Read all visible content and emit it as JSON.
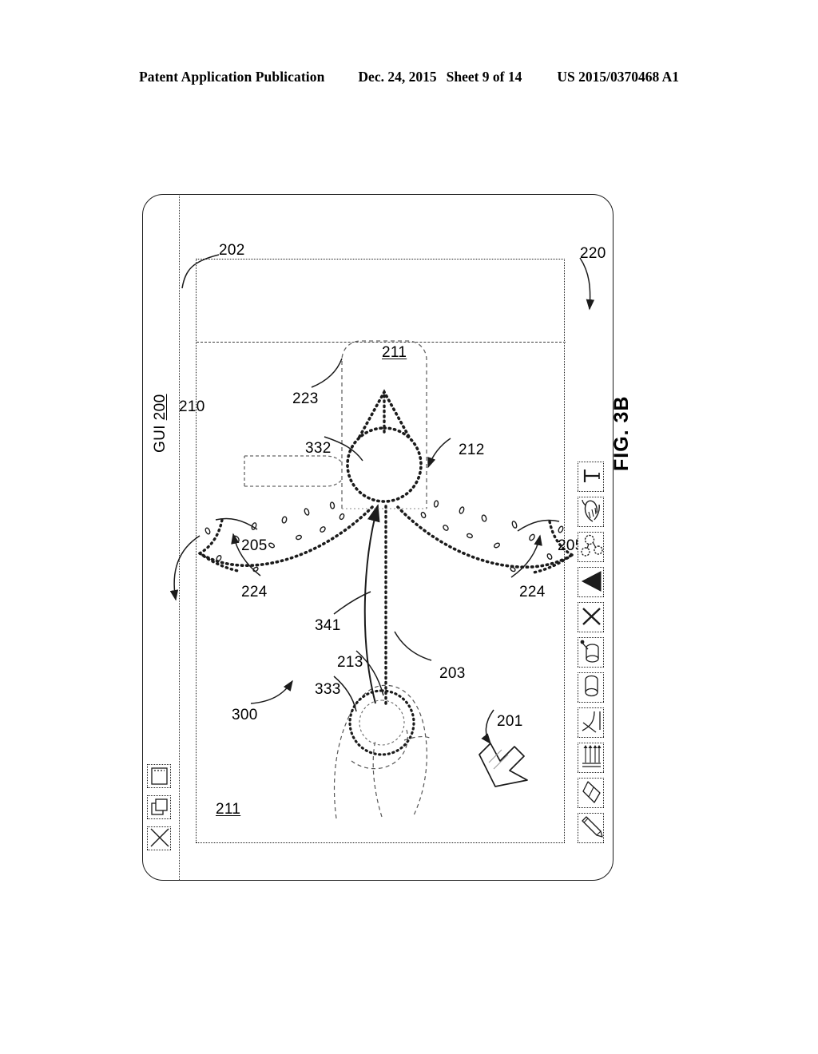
{
  "header": {
    "publication": "Patent Application Publication",
    "date": "Dec. 24, 2015",
    "sheet": "Sheet 9 of 14",
    "patent_number": "US 2015/0370468 A1"
  },
  "figure": {
    "caption": "FIG. 3B"
  },
  "window": {
    "gui_label_text": "GUI ",
    "gui_label_number": "200",
    "controls": [
      {
        "name": "close-button",
        "glyph": "x-box"
      },
      {
        "name": "restore-button",
        "glyph": "overlapping-squares"
      },
      {
        "name": "minimize-button",
        "glyph": "box-with-line"
      }
    ]
  },
  "toolbar": {
    "items": [
      {
        "label": "pencil-tool",
        "icon": "pencil-icon"
      },
      {
        "label": "eraser-tool",
        "icon": "eraser-icon"
      },
      {
        "label": "flow-lines-tool",
        "icon": "flow-lines-icon"
      },
      {
        "label": "curve-tool",
        "icon": "curve-icon"
      },
      {
        "label": "cylinder-tool",
        "icon": "cylinder-icon"
      },
      {
        "label": "cylinder-pour-tool",
        "icon": "cylinder-pour-icon"
      },
      {
        "label": "delete-tool",
        "icon": "x-cross-icon"
      },
      {
        "label": "cone-tool",
        "icon": "filled-triangle-icon"
      },
      {
        "label": "molecule-tool",
        "icon": "molecule-icon"
      },
      {
        "label": "hand-tool",
        "icon": "hand-icon"
      },
      {
        "label": "text-tool",
        "icon": "text-t-icon"
      }
    ]
  },
  "refs": {
    "r201": "201",
    "r202": "202",
    "r203": "203",
    "r205_upper": "205",
    "r205_lower": "205",
    "r210": "210",
    "r211_top": "211",
    "r211_bottom": "211",
    "r212": "212",
    "r213": "213",
    "r220": "220",
    "r223": "223",
    "r224_upper": "224",
    "r224_lower": "224",
    "r300": "300",
    "r332": "332",
    "r333": "333",
    "r341": "341"
  },
  "colors": {
    "ink": "#1b1b1b",
    "paper": "#ffffff",
    "faint": "#707070"
  }
}
